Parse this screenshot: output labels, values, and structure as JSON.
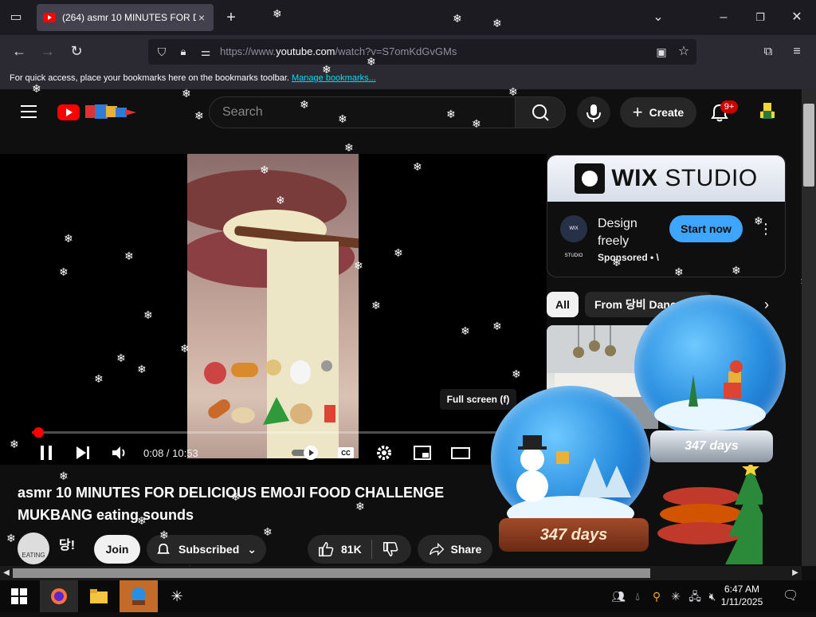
{
  "browser": {
    "tab_title": "(264) asmr 10 MINUTES FOR DE",
    "tab_close": "×",
    "new_tab": "+",
    "url_prefix": "https://www.",
    "url_host": "youtube.com",
    "url_path": "/watch?v=S7omKdGvGMs",
    "bookmarks_text": "For quick access, place your bookmarks here on the bookmarks toolbar.",
    "bookmarks_link": "Manage bookmarks..."
  },
  "youtube": {
    "search_placeholder": "Search",
    "create_label": "Create",
    "notifications_badge": "9+"
  },
  "player": {
    "time": "0:08 / 10:53",
    "tooltip": "Full screen (f)",
    "progress_fraction": 0.013
  },
  "video": {
    "title": "asmr 10 MINUTES FOR DELICIOUS EMOJI FOOD CHALLENGE MUKBANG eating sounds",
    "channel_name": "당!",
    "channel_avatar_text": "EATING",
    "join_label": "Join",
    "subscribed_label": "Subscribed",
    "likes": "81K",
    "share_label": "Share"
  },
  "ad": {
    "brand_bold": "WIX",
    "brand_light": "STUDIO",
    "icon_text": "WIX STUDIO",
    "line1": "Design",
    "line2": "freely",
    "sponsored": "Sponsored • \\",
    "cta": "Start now"
  },
  "chips": {
    "all": "All",
    "from": "From 당비 Danc"
  },
  "globes": {
    "days_label": "347 days"
  },
  "taskbar": {
    "time": "6:47 AM",
    "date": "1/11/2025"
  }
}
